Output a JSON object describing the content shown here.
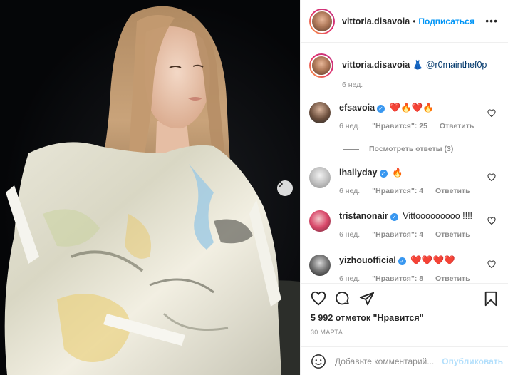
{
  "header": {
    "username": "vittoria.disavoia",
    "dot": "•",
    "follow_label": "Подписаться",
    "more_label": "•••"
  },
  "caption": {
    "username": "vittoria.disavoia",
    "emoji": "👗",
    "mention": "@r0mainthef0p",
    "time": "6 нед."
  },
  "comments": [
    {
      "username": "efsavoia",
      "verified": true,
      "text": "❤️🔥❤️🔥",
      "time": "6 нед.",
      "likes": "\"Нравится\": 25",
      "reply": "Ответить"
    },
    {
      "username": "lhallyday",
      "verified": true,
      "text": "🔥",
      "time": "6 нед.",
      "likes": "\"Нравится\": 4",
      "reply": "Ответить"
    },
    {
      "username": "tristanonair",
      "verified": true,
      "text": "Vittooooooooo !!!!",
      "time": "6 нед.",
      "likes": "\"Нравится\": 4",
      "reply": "Ответить"
    },
    {
      "username": "yizhouofficial",
      "verified": true,
      "text": "❤️❤️❤️❤️",
      "time": "6 нед.",
      "likes": "\"Нравится\": 8",
      "reply": "Ответить"
    }
  ],
  "view_replies": "Посмотреть ответы (3)",
  "likes_count": "5 992 отметок \"Нравится\"",
  "post_date": "30 МАРТА",
  "add_comment": {
    "placeholder": "Добавьте комментарий...",
    "post_label": "Опубликовать"
  },
  "colors": {
    "accent": "#0095f6",
    "verified": "#3897f0",
    "muted": "#8e8e8e",
    "post_disabled": "#b2dffc"
  },
  "icons": [
    "smile-icon",
    "heart-icon",
    "comment-icon",
    "share-icon",
    "bookmark-icon",
    "chevron-right-icon"
  ]
}
